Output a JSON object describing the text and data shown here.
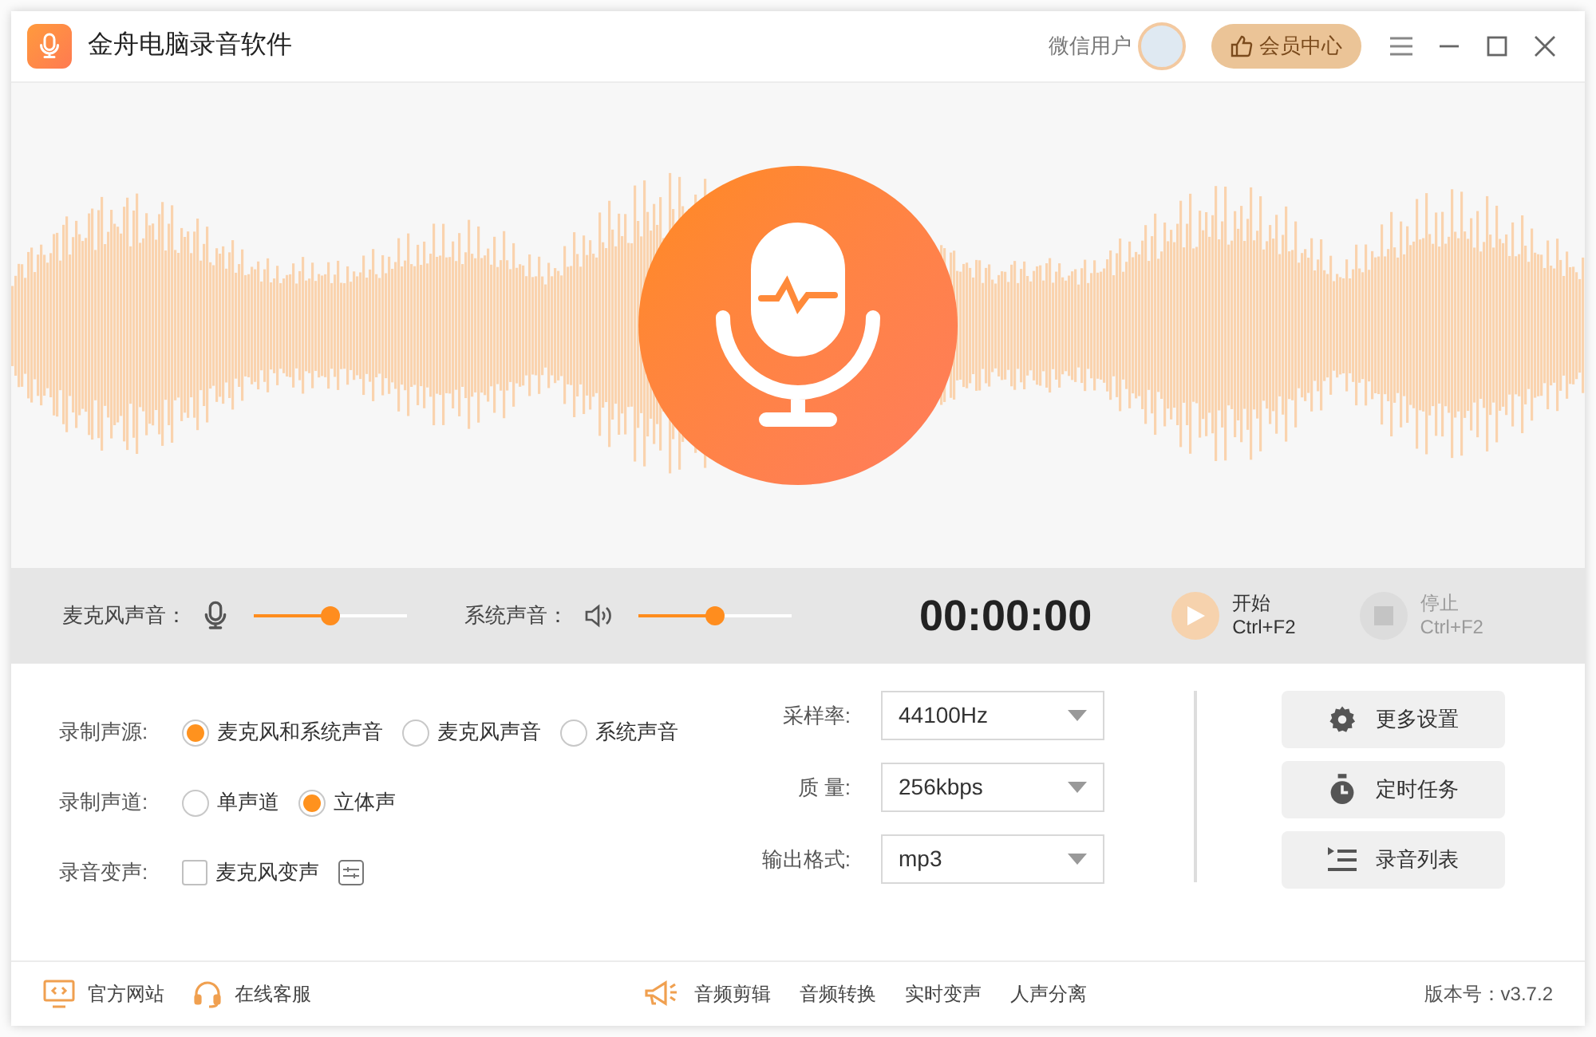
{
  "app": {
    "title": "金舟电脑录音软件"
  },
  "user": {
    "name": "微信用户"
  },
  "vip_button": "会员中心",
  "volume": [
    {
      "kind": "mic",
      "label": "麦克风声音：",
      "level": 0.5
    },
    {
      "kind": "speaker",
      "label": "系统声音：",
      "level": 0.5
    }
  ],
  "timer": "00:00:00",
  "transport": [
    {
      "kind": "start",
      "label": "开始",
      "shortcut": "Ctrl+F2",
      "disabled": false
    },
    {
      "kind": "stop",
      "label": "停止",
      "shortcut": "Ctrl+F2",
      "disabled": true
    }
  ],
  "settings": [
    {
      "kind": "radio",
      "label": "录制声源:",
      "options": [
        {
          "label": "麦克风和系统声音",
          "selected": true
        },
        {
          "label": "麦克风声音",
          "selected": false
        },
        {
          "label": "系统声音",
          "selected": false
        }
      ]
    },
    {
      "kind": "radio",
      "label": "录制声道:",
      "options": [
        {
          "label": "单声道",
          "selected": false
        },
        {
          "label": "立体声",
          "selected": true
        }
      ]
    },
    {
      "kind": "checkbox",
      "label": "录音变声:",
      "checkbox": {
        "label": "麦克风变声",
        "checked": false
      }
    }
  ],
  "selects": [
    {
      "label": "采样率:",
      "value": "44100Hz"
    },
    {
      "label": "质 量:",
      "value": "256kbps"
    },
    {
      "label": "输出格式:",
      "value": "mp3"
    }
  ],
  "actions": [
    {
      "kind": "gear",
      "label": "更多设置"
    },
    {
      "kind": "timer",
      "label": "定时任务"
    },
    {
      "kind": "list",
      "label": "录音列表"
    }
  ],
  "footer": {
    "links": [
      {
        "kind": "monitor",
        "label": "官方网站"
      },
      {
        "kind": "headset",
        "label": "在线客服"
      }
    ],
    "tools": [
      "音频剪辑",
      "音频转换",
      "实时变声",
      "人声分离"
    ],
    "version": "版本号：v3.7.2"
  }
}
